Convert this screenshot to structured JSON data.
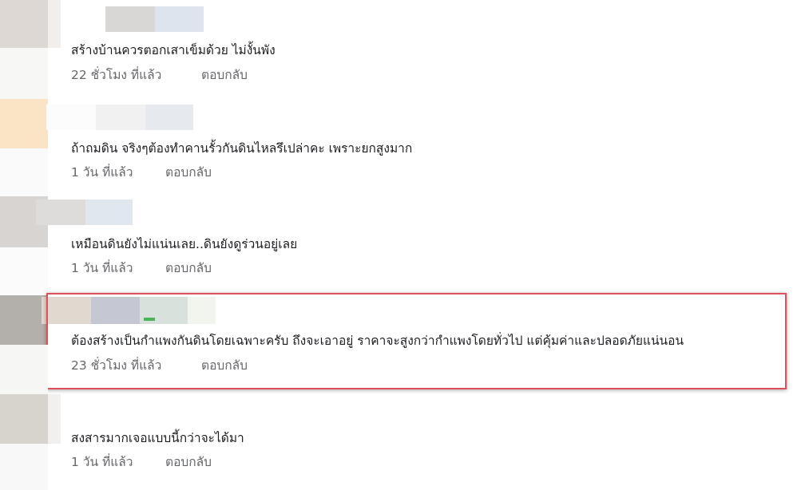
{
  "comments": [
    {
      "text": "สร้างบ้านควรตอกเสาเข็มด้วย ไม่งั้นพัง",
      "time": "22 ชั่วโมง ที่แล้ว",
      "reply": "ตอบกลับ"
    },
    {
      "text": "ถ้าถมดิน จริงๆต้องทำคานรั้วกันดินไหลรึเปล่าคะ เพราะยกสูงมาก",
      "time": "1 วัน ที่แล้ว",
      "reply": "ตอบกลับ"
    },
    {
      "text": "เหมือนดินยังไม่แน่นเลย..ดินยังดูร่วนอยู่เลย",
      "time": "1 วัน ที่แล้ว",
      "reply": "ตอบกลับ"
    },
    {
      "text": "ต้องสร้างเป็นกำแพงกันดินโดยเฉพาะครับ ถึงจะเอาอยู่ ราคาจะสูงกว่ากำแพงโดยทั่วไป แต่คุ้มค่าและปลอดภัยแน่นอน",
      "time": "23 ชั่วโมง ที่แล้ว",
      "reply": "ตอบกลับ",
      "highlighted": true
    },
    {
      "text": "สงสารมากเจอแบบนี้กว่าจะได้มา",
      "time": "1 วัน ที่แล้ว",
      "reply": "ตอบกลับ"
    }
  ],
  "colors": {
    "highlight_border": "#e0505a",
    "meta_text": "#65676b",
    "body_text": "#1c1e21"
  }
}
